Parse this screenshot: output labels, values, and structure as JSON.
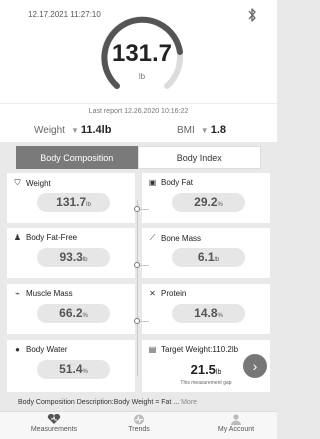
{
  "header": {
    "datetime": "12.17.2021 11:27:10",
    "bluetooth_icon": "bluetooth-icon",
    "weight_value": "131.7",
    "weight_unit": "lb",
    "last_report": "Last report 12.26.2020 10:16:22"
  },
  "summary": {
    "weight_label": "Weight",
    "weight_change": "11.4lb",
    "bmi_label": "BMI",
    "bmi_change": "1.8"
  },
  "tabs": [
    {
      "label": "Body Composition",
      "active": true
    },
    {
      "label": "Body Index",
      "active": false
    }
  ],
  "cards": {
    "weight": {
      "label": "Weight",
      "value": "131.7",
      "unit": "lb",
      "icon": "scale-icon"
    },
    "body_fat": {
      "label": "Body Fat",
      "value": "29.2",
      "unit": "%",
      "icon": "body-fat-icon"
    },
    "body_fat_free": {
      "label": "Body Fat-Free",
      "value": "93.3",
      "unit": "lb",
      "icon": "person-icon"
    },
    "bone_mass": {
      "label": "Bone Mass",
      "value": "6.1",
      "unit": "lb",
      "icon": "bone-icon"
    },
    "muscle_mass": {
      "label": "Muscle Mass",
      "value": "66.2",
      "unit": "%",
      "icon": "muscle-icon"
    },
    "protein": {
      "label": "Protein",
      "value": "14.8",
      "unit": "%",
      "icon": "protein-icon"
    },
    "body_water": {
      "label": "Body Water",
      "value": "51.4",
      "unit": "%",
      "icon": "water-drop-icon"
    },
    "target_weight": {
      "label": "Target Weight:110.2lb",
      "value": "21.5",
      "unit": "lb",
      "note": "This measurement gap",
      "icon": "target-icon"
    }
  },
  "description": {
    "text": "Body Composition Description:Body Weight = Fat ...",
    "more": "More"
  },
  "nav": [
    {
      "label": "Measurements",
      "icon": "heart-shield-icon"
    },
    {
      "label": "Trends",
      "icon": "pulse-icon"
    },
    {
      "label": "My Account",
      "icon": "user-icon"
    }
  ],
  "colors": {
    "background": "#e9e9e9",
    "active_tab": "#7a7a7a",
    "pill": "#e6e6e6",
    "gauge": "#555555"
  }
}
